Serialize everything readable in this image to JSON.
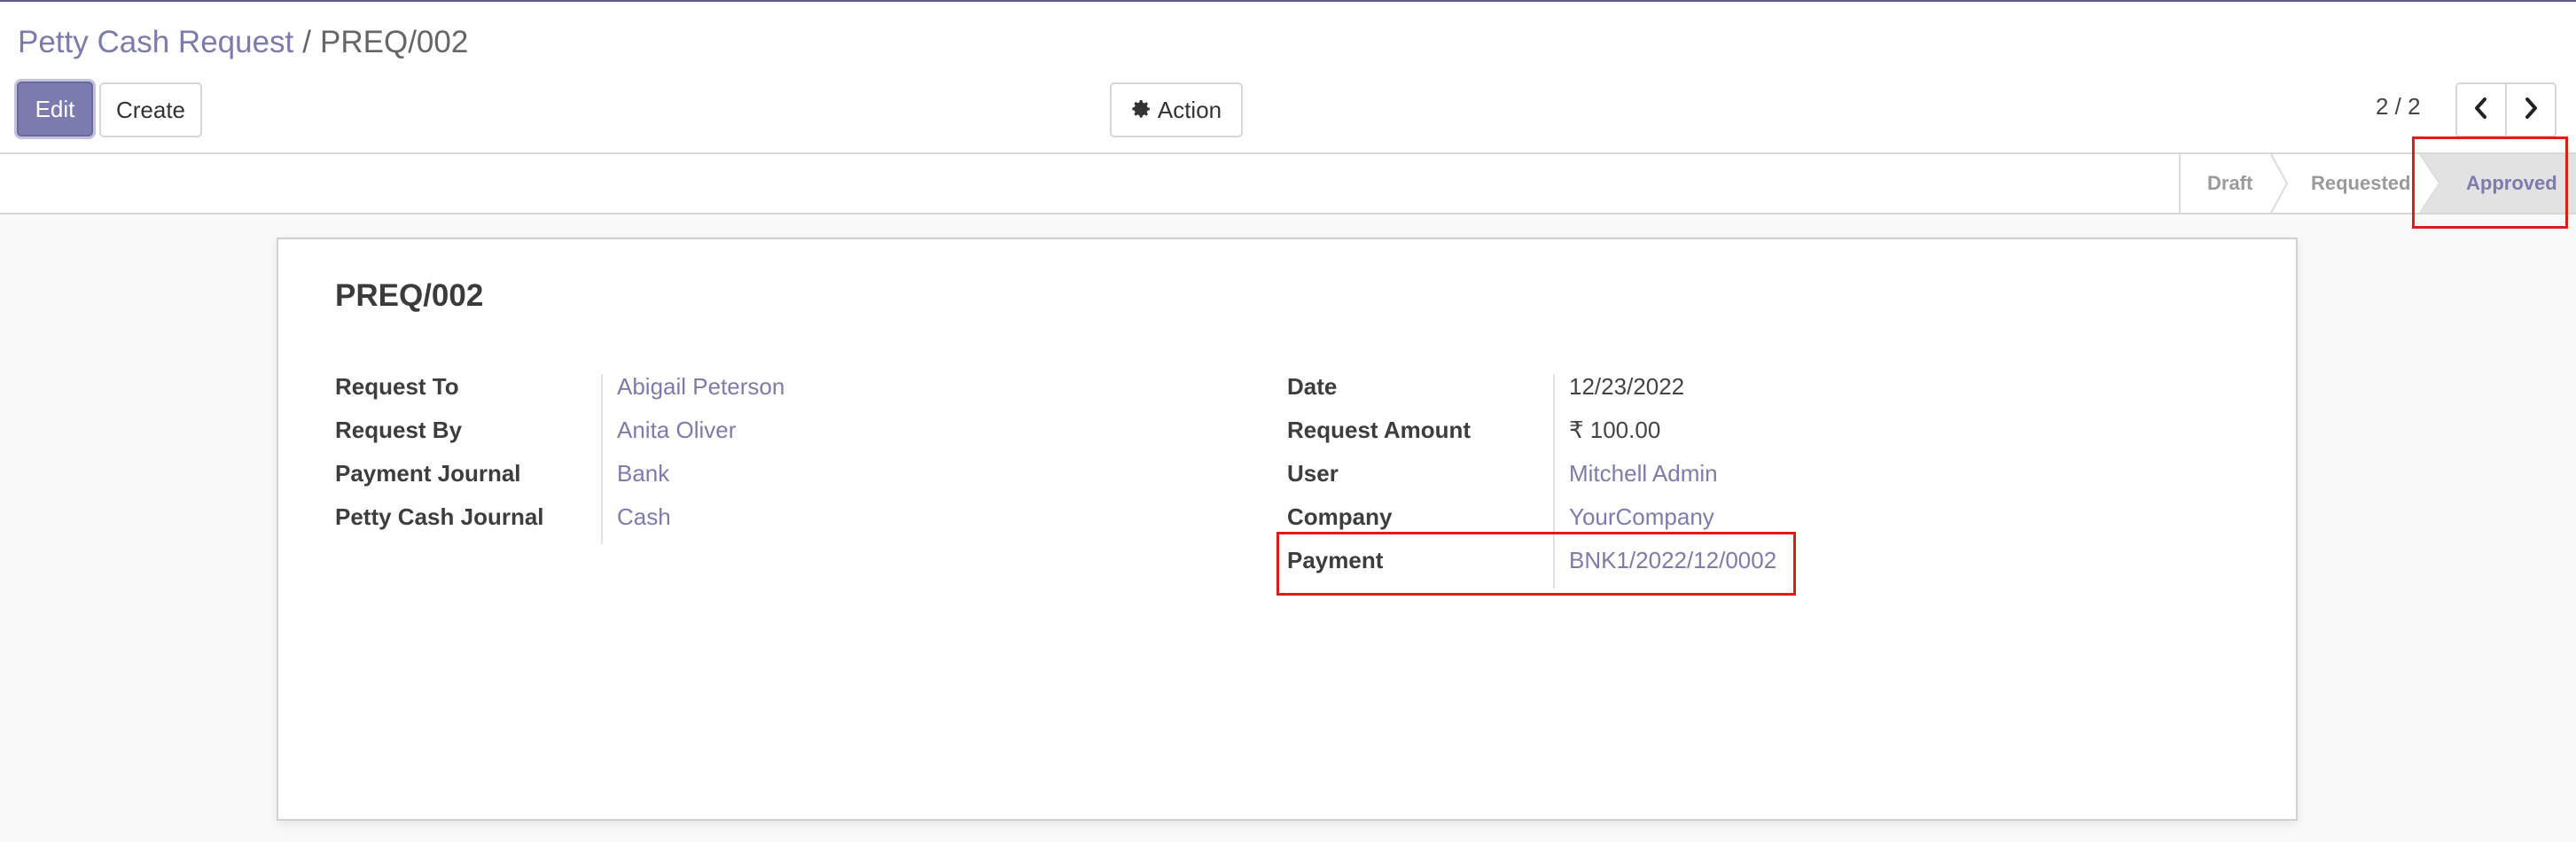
{
  "breadcrumb": {
    "parent": "Petty Cash Request",
    "separator": "/",
    "current": "PREQ/002"
  },
  "toolbar": {
    "edit_label": "Edit",
    "create_label": "Create",
    "action_label": "Action",
    "action_icon": "gear-icon"
  },
  "pager": {
    "value": "2 / 2",
    "prev_icon": "chevron-left-icon",
    "next_icon": "chevron-right-icon"
  },
  "status": {
    "stages": [
      "Draft",
      "Requested",
      "Approved"
    ],
    "current": "Approved"
  },
  "record": {
    "title": "PREQ/002",
    "left_fields": [
      {
        "label": "Request To",
        "value": "Abigail Peterson"
      },
      {
        "label": "Request By",
        "value": "Anita Oliver"
      },
      {
        "label": "Payment Journal",
        "value": "Bank"
      },
      {
        "label": "Petty Cash Journal",
        "value": "Cash"
      }
    ],
    "right_fields": [
      {
        "label": "Date",
        "value": "12/23/2022"
      },
      {
        "label": "Request Amount",
        "value": "₹ 100.00"
      },
      {
        "label": "User",
        "value": "Mitchell Admin"
      },
      {
        "label": "Company",
        "value": "YourCompany"
      },
      {
        "label": "Payment",
        "value": "BNK1/2022/12/0002"
      }
    ]
  },
  "colors": {
    "accent": "#7c7bad",
    "highlight": "#e01b1b"
  }
}
